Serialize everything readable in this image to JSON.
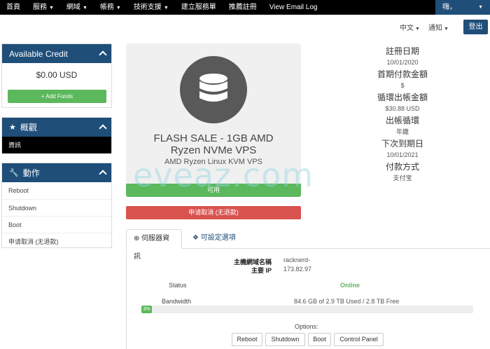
{
  "nav": {
    "items": [
      {
        "label": "首頁",
        "caret": false
      },
      {
        "label": "服務",
        "caret": true
      },
      {
        "label": "網域",
        "caret": true
      },
      {
        "label": "帳務",
        "caret": true
      },
      {
        "label": "技術支援",
        "caret": true
      },
      {
        "label": "建立服務單",
        "caret": false
      },
      {
        "label": "推薦註冊",
        "caret": false
      },
      {
        "label": "View Email Log",
        "caret": false
      }
    ],
    "user": "嗨，"
  },
  "subbar": {
    "language": "中文",
    "notifications": "通知",
    "logout": "登出"
  },
  "sidebar": {
    "credit": {
      "title": "Available Credit",
      "value": "$0.00 USD",
      "add_funds": "+ Add Funds"
    },
    "overview": {
      "title": "概觀",
      "items": [
        "資訊"
      ]
    },
    "actions": {
      "title": "動作",
      "items": [
        "Reboot",
        "Shutdown",
        "Boot",
        "申请取消 (无退款)"
      ]
    }
  },
  "product": {
    "title_line1": "FLASH SALE - 1GB AMD",
    "title_line2": "Ryzen NVMe VPS",
    "subtitle": "AMD Ryzen Linux KVM VPS",
    "status": "可用",
    "cancel": "申请取消 (无退款)"
  },
  "info": [
    {
      "label": "註冊日期",
      "value": "10/01/2020"
    },
    {
      "label": "首期付款金額",
      "value": "$"
    },
    {
      "label": "循環出帳金額",
      "value": "$30.88 USD"
    },
    {
      "label": "出帳循環",
      "value": "年繳"
    },
    {
      "label": "下次到期日",
      "value": "10/01/2021"
    },
    {
      "label": "付款方式",
      "value": "支付宝"
    }
  ],
  "watermark": "eveaz.com",
  "tabs": {
    "server_info": "伺服器資訊",
    "settings": "可設定選項"
  },
  "server": {
    "hostname_label": "主機網域名稱",
    "hostname_value": "racknerd-",
    "ip_label": "主要 IP",
    "ip_value": "173.82.97",
    "status_label": "Status",
    "status_value": "Online",
    "bandwidth_label": "Bandwidth",
    "bandwidth_value": "84.6 GB of 2.9 TB Used / 2.8 TB Free",
    "bandwidth_percent": 3,
    "bandwidth_percent_label": "3%",
    "options_label": "Options:",
    "buttons": [
      "Reboot",
      "Shutdown",
      "Boot",
      "Control Panel"
    ]
  },
  "colors": {
    "brand": "#1f4e79",
    "success": "#5cb85c",
    "danger": "#d9534f"
  }
}
